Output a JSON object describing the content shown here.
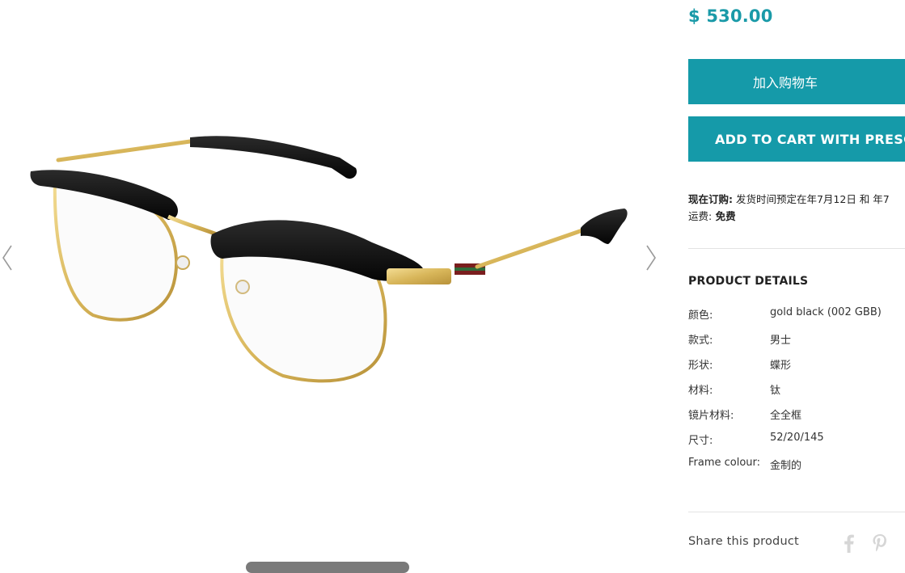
{
  "product": {
    "price": "$ 530.00"
  },
  "buttons": {
    "add_to_cart": "加入购物车",
    "add_to_cart_prescription": "ADD TO CART WITH PRESCRIPTION"
  },
  "order_note": {
    "now_order_label": "现在订购:",
    "now_order_value": " 发货时间预定在年7月12日 和 年7",
    "shipping_label": "运费:",
    "shipping_value": " 免费"
  },
  "details": {
    "title": "PRODUCT DETAILS",
    "rows": [
      {
        "key": "颜色:",
        "value": "gold black (002 GBB)"
      },
      {
        "key": "款式:",
        "value": "男士"
      },
      {
        "key": "形状:",
        "value": "蝶形"
      },
      {
        "key": "材料:",
        "value": "钛"
      },
      {
        "key": "镜片材料:",
        "value": "全全框"
      },
      {
        "key": "尺寸:",
        "value": "52/20/145"
      },
      {
        "key": "Frame colour:",
        "value": "金制的"
      }
    ]
  },
  "share": {
    "label": "Share this product",
    "icons": [
      "facebook-icon",
      "pinterest-icon"
    ]
  },
  "gallery": {
    "icons": [
      "chevron-left-icon",
      "chevron-right-icon"
    ]
  },
  "colors": {
    "accent": "#159aa9",
    "price": "#1a9aa8"
  }
}
